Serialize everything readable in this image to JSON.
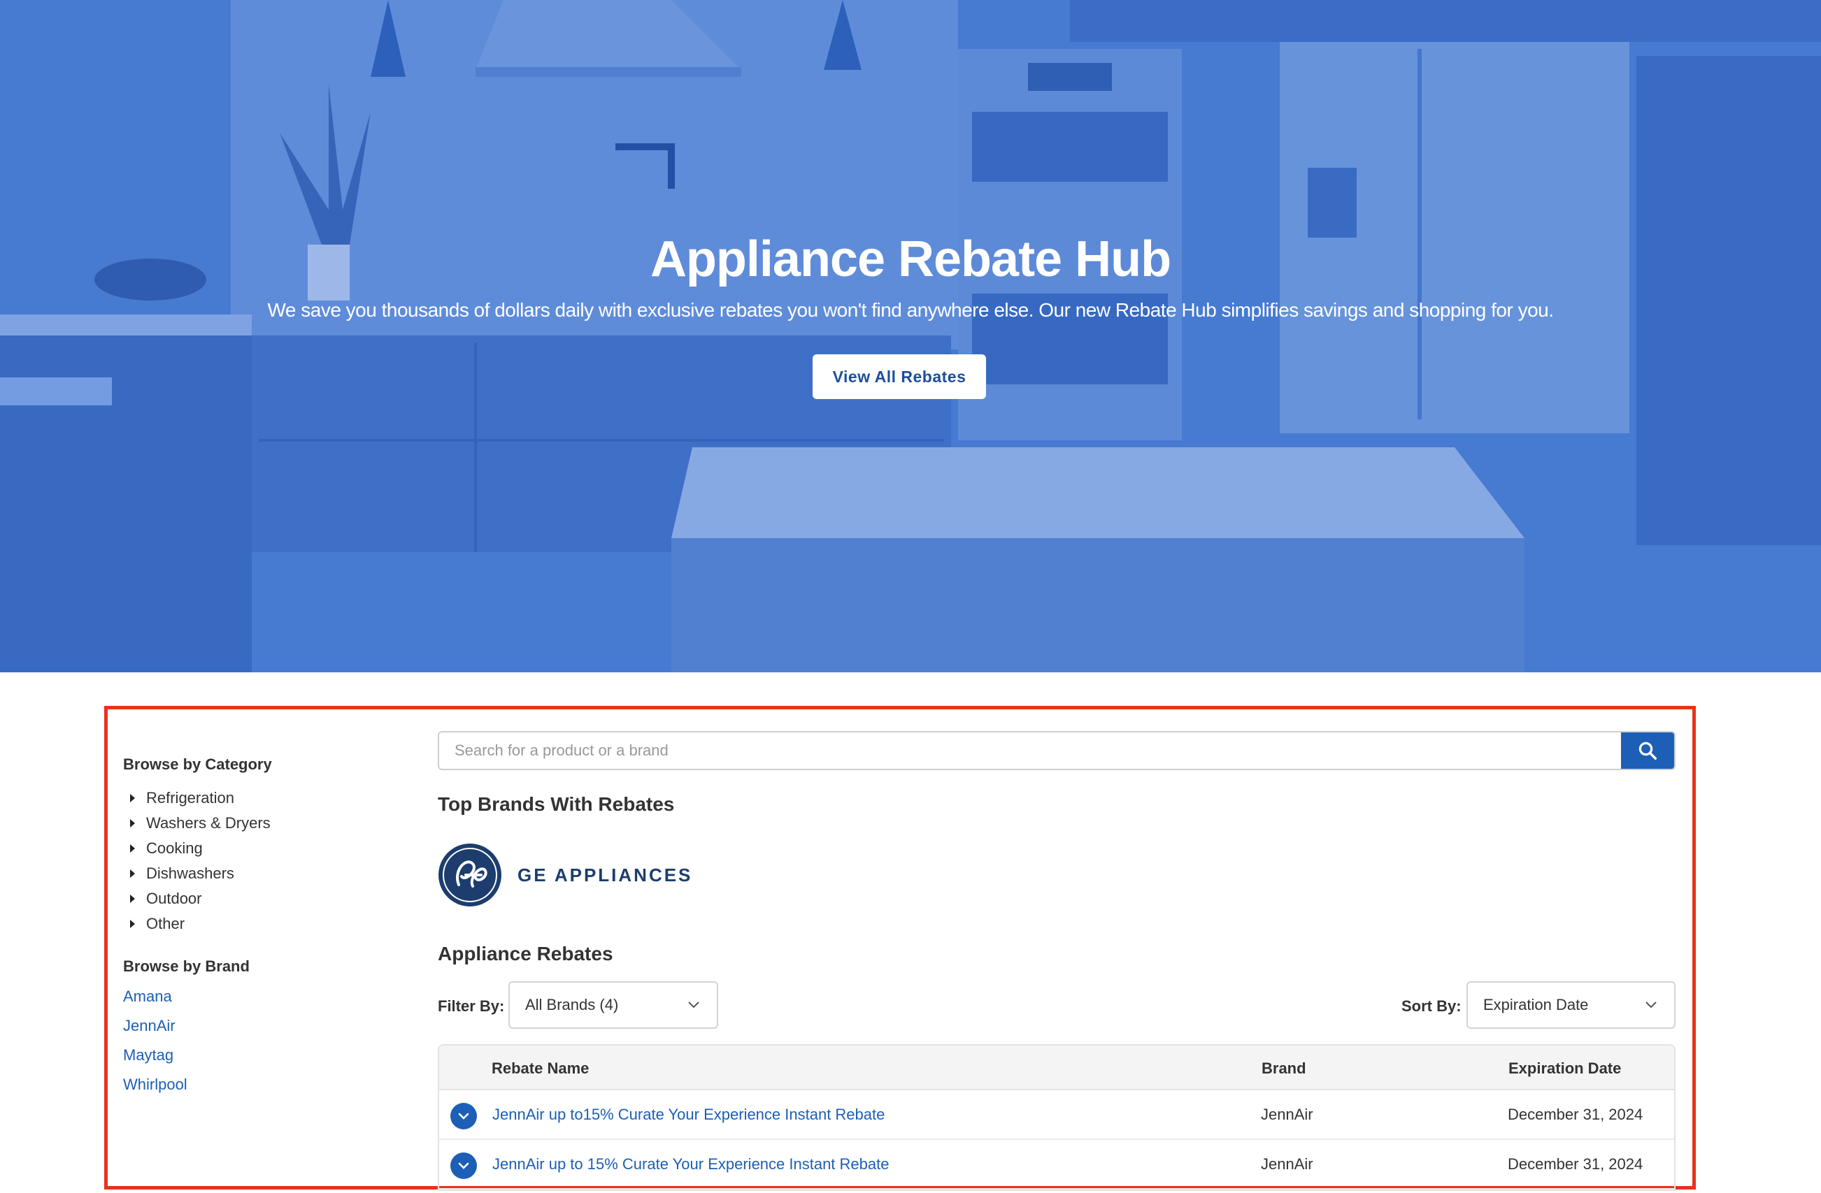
{
  "hero": {
    "title": "Appliance Rebate Hub",
    "subtitle": "We save you thousands of dollars daily with exclusive rebates you won't find anywhere else. Our new Rebate Hub simplifies savings and shopping for you.",
    "cta_label": "View All Rebates"
  },
  "sidebar": {
    "category_heading": "Browse by Category",
    "categories": [
      "Refrigeration",
      "Washers & Dryers",
      "Cooking",
      "Dishwashers",
      "Outdoor",
      "Other"
    ],
    "brand_heading": "Browse by Brand",
    "brands": [
      "Amana",
      "JennAir",
      "Maytag",
      "Whirlpool"
    ]
  },
  "search": {
    "placeholder": "Search for a product or a brand"
  },
  "top_brands": {
    "title": "Top Brands With Rebates",
    "logo_text": "GE APPLIANCES"
  },
  "rebates": {
    "title": "Appliance Rebates",
    "filter_label": "Filter By:",
    "filter_value": "All Brands (4)",
    "sort_label": "Sort By:",
    "sort_value": "Expiration Date",
    "columns": [
      "Rebate Name",
      "Brand",
      "Expiration Date"
    ],
    "rows": [
      {
        "name": "JennAir up to15% Curate Your Experience Instant Rebate",
        "brand": "JennAir",
        "expiration": "December 31, 2024"
      },
      {
        "name": "JennAir up to 15% Curate Your Experience Instant Rebate",
        "brand": "JennAir",
        "expiration": "December 31, 2024"
      }
    ]
  },
  "colors": {
    "hero_tint": "#4a7bd1",
    "link_blue": "#1d5fb6",
    "highlight_red": "#e8321e"
  }
}
